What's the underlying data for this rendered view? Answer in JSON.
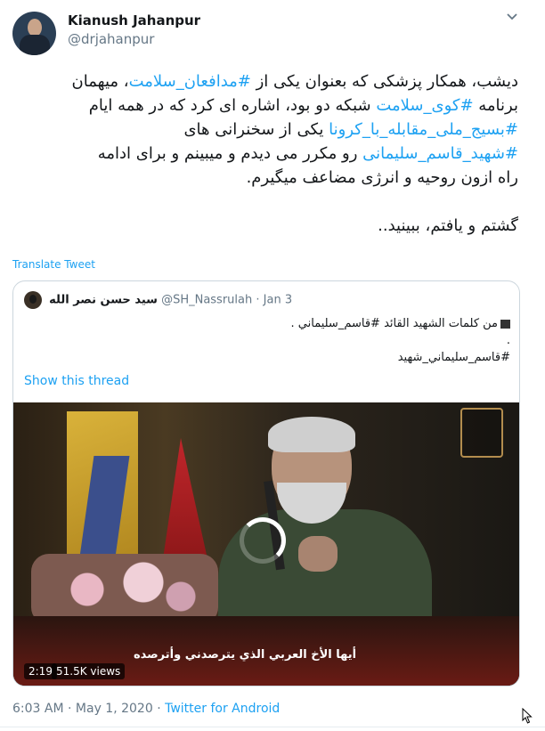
{
  "author": {
    "name": "Kianush Jahanpur",
    "handle": "@drjahanpur",
    "avatar_icon": "profile-photo"
  },
  "tweet": {
    "lines": [
      [
        "دیشب، همکار پزشکی که بعنوان یکی از ",
        "#مدافعان_سلامت",
        "، میهمان"
      ],
      [
        "برنامه ",
        "#کوی_سلامت",
        " شبکه دو بود، اشاره ای کرد که در همه ایام"
      ],
      [
        "",
        "#بسیج_ملی_مقابله_با_کرونا",
        " یکی از سخنرانی های"
      ],
      [
        "",
        "#شهید_قاسم_سلیمانی",
        "  رو مکرر می دیدم و میبینم و برای ادامه"
      ],
      [
        "راه ازون روحیه و انرژی مضاعف میگیرم.",
        "",
        ""
      ]
    ],
    "last_line": "گشتم و یافتم، ببینید..",
    "hashtag_color": "#1da1f2"
  },
  "translate_label": "Translate Tweet",
  "quote": {
    "name": "سید حسن نصر الله",
    "handle": "@SH_Nassrulah",
    "separator": "·",
    "date": "Jan 3",
    "text_line1": "من كلمات الشهيد القائد #قاسم_سليماني .",
    "text_line2": ".",
    "text_line3": "#قاسم_سليماني_شهيد",
    "show_thread": "Show this thread",
    "video": {
      "caption": "أيها الأخ العربي الذي يترصدني وأترصده",
      "duration": "2:19",
      "views": "51.5K views"
    }
  },
  "footer": {
    "time": "6:03 AM",
    "sep": "·",
    "date": "May 1, 2020",
    "source": "Twitter for Android"
  },
  "colors": {
    "link": "#1da1f2",
    "muted": "#657786",
    "text": "#14171a",
    "border": "#ccd6dd"
  }
}
